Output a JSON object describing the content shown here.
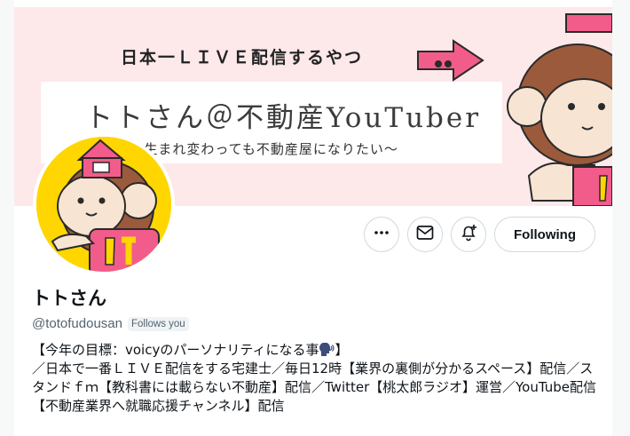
{
  "banner": {
    "headline": "日本一ＬＩＶＥ配信するやつ",
    "name": "トトさん＠不動産YouTuber",
    "subtitle": "-生まれ変わっても不動産屋になりたい～"
  },
  "actions": {
    "more_icon": "more-horizontal-icon",
    "message_icon": "envelope-icon",
    "notify_icon": "bell-plus-icon",
    "following_label": "Following"
  },
  "profile": {
    "display_name": "トトさん",
    "handle": "@totofudousan",
    "follows_you": "Follows you",
    "bio_line1": "【今年の目標：voicyのパーソナリティになる事",
    "bio_line1_end": "】",
    "bio_rest": "／日本で一番ＬＩＶＥ配信をする宅建士／毎日12時【業界の裏側が分かるスペース】配信／スタンドｆｍ【教科書には載らない不動産】配信／Twitter【桃太郎ラジオ】運営／YouTube配信【不動産業界へ就職応援チャンネル】配信"
  },
  "colors": {
    "banner_bg": "#fde8ea",
    "avatar_bg": "#ffd600",
    "text_secondary": "#536471",
    "border": "#cfd9de"
  }
}
